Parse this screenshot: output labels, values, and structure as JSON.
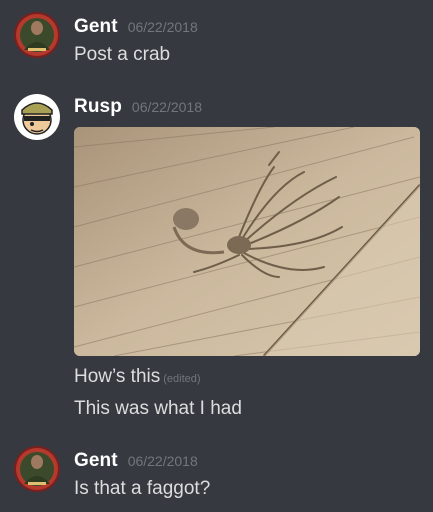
{
  "messages": [
    {
      "username": "Gent",
      "timestamp": "06/22/2018",
      "lines": [
        "Post a crab"
      ]
    },
    {
      "username": "Rusp",
      "timestamp": "06/22/2018",
      "attachment": "photo of a harvestman spider on a wooden floor",
      "lines": [
        "How’s this",
        "This was what I had"
      ],
      "edited_label": "(edited)"
    },
    {
      "username": "Gent",
      "timestamp": "06/22/2018",
      "lines": [
        "Is that a faggot?"
      ]
    }
  ],
  "colors": {
    "background": "#36393f",
    "username": "#ffffff",
    "message_text": "#dcddde",
    "timestamp": "#72767d"
  }
}
